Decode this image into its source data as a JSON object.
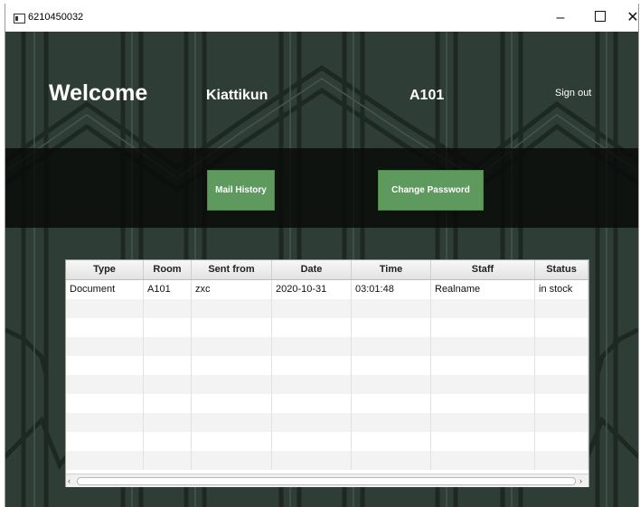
{
  "window": {
    "title": "6210450032",
    "minimize_glyph": "–",
    "close_glyph": "✕"
  },
  "header": {
    "welcome": "Welcome",
    "username": "Kiattikun",
    "room": "A101",
    "sign_out": "Sign out"
  },
  "actions": {
    "mail_history": "Mail History",
    "change_password": "Change Password"
  },
  "table": {
    "columns": [
      "Type",
      "Room",
      "Sent from",
      "Date",
      "Time",
      "Staff",
      "Status"
    ],
    "rows": [
      [
        "Document",
        "A101",
        "zxc",
        "2020-10-31",
        "03:01:48",
        "Realname",
        "in stock"
      ]
    ]
  },
  "colors": {
    "background": "#2e3e36",
    "button": "#5e9a5e",
    "band": "#0a0c0b"
  },
  "icons": {
    "app": "app-window-icon",
    "scroll_left": "chevron-left-icon",
    "scroll_right": "chevron-right-icon"
  }
}
